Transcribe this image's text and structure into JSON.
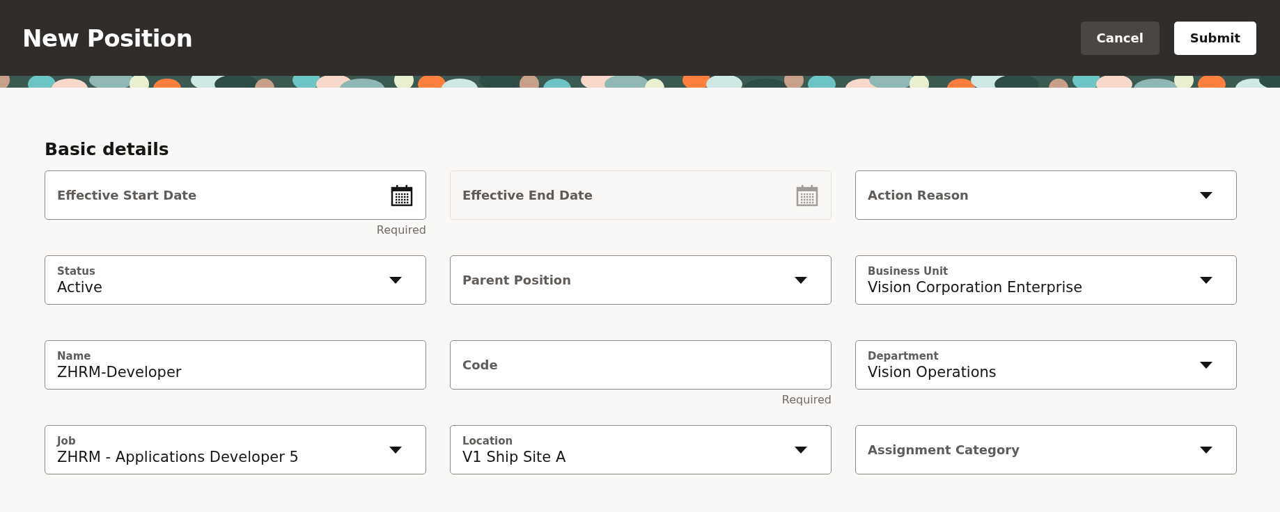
{
  "header": {
    "title": "New Position",
    "buttons": [
      {
        "label": "Cancel",
        "kind": "secondary"
      },
      {
        "label": "Submit",
        "kind": "primary"
      }
    ]
  },
  "section": {
    "title": "Basic details",
    "fields": [
      {
        "kind": "date",
        "label": "Effective Start Date",
        "disabled": false,
        "helper": "Required"
      },
      {
        "kind": "date",
        "label": "Effective End Date",
        "disabled": true
      },
      {
        "kind": "select",
        "label": "Action Reason",
        "disabled": false
      },
      {
        "kind": "select",
        "label": "Status",
        "value": "Active",
        "disabled": false
      },
      {
        "kind": "select",
        "label": "Parent Position",
        "disabled": false
      },
      {
        "kind": "select",
        "label": "Business Unit",
        "value": "Vision Corporation Enterprise",
        "disabled": false
      },
      {
        "kind": "text",
        "label": "Name",
        "value": "ZHRM-Developer",
        "disabled": false
      },
      {
        "kind": "text",
        "label": "Code",
        "disabled": false,
        "helper": "Required"
      },
      {
        "kind": "select",
        "label": "Department",
        "value": "Vision Operations",
        "disabled": false
      },
      {
        "kind": "select",
        "label": "Job",
        "value": "ZHRM - Applications Developer 5",
        "disabled": false
      },
      {
        "kind": "select",
        "label": "Location",
        "value": "V1 Ship Site A",
        "disabled": false
      },
      {
        "kind": "select",
        "label": "Assignment Category",
        "disabled": false
      }
    ]
  }
}
